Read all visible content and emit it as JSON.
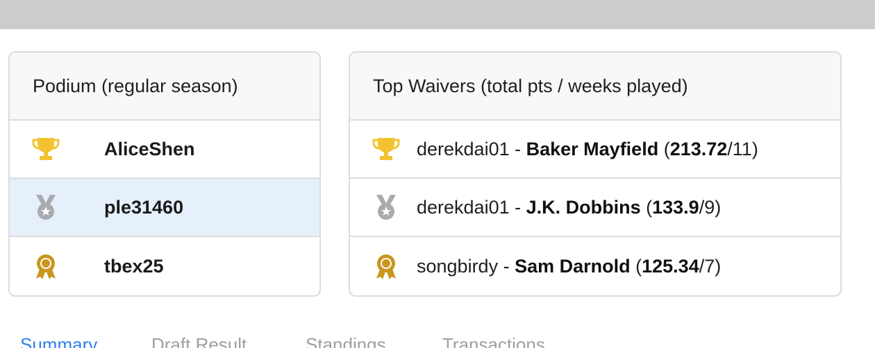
{
  "podium": {
    "title": "Podium (regular season)",
    "rows": [
      {
        "icon": "trophy-icon",
        "name": "AliceShen",
        "highlight": false
      },
      {
        "icon": "silver-medal-icon",
        "name": "ple31460",
        "highlight": true
      },
      {
        "icon": "bronze-award-icon",
        "name": "tbex25",
        "highlight": false
      }
    ]
  },
  "waivers": {
    "title": "Top Waivers (total pts / weeks played)",
    "rows": [
      {
        "icon": "trophy-icon",
        "owner": "derekdai01",
        "sep": " - ",
        "player": "Baker Mayfield",
        "open": " (",
        "pts": "213.72",
        "weeks": "/11)"
      },
      {
        "icon": "silver-medal-icon",
        "owner": "derekdai01",
        "sep": " - ",
        "player": "J.K. Dobbins",
        "open": " (",
        "pts": "133.9",
        "weeks": "/9)"
      },
      {
        "icon": "bronze-award-icon",
        "owner": "songbirdy",
        "sep": " - ",
        "player": "Sam Darnold",
        "open": " (",
        "pts": "125.34",
        "weeks": "/7)"
      }
    ]
  },
  "tabs": [
    {
      "label": "Summary",
      "active": true
    },
    {
      "label": "Draft Result",
      "active": false
    },
    {
      "label": "Standings",
      "active": false
    },
    {
      "label": "Transactions",
      "active": false
    }
  ],
  "colors": {
    "gold": "#f2c230",
    "silver": "#a9abae",
    "bronze": "#c9961f",
    "highlight": "#e6f0fb",
    "active_tab": "#2f80ed"
  }
}
